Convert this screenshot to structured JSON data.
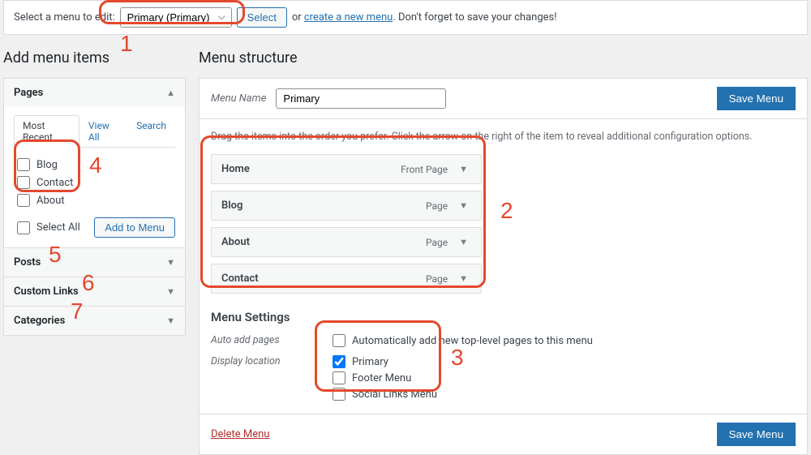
{
  "editBar": {
    "labelPre": "Select a menu to edit:",
    "dropdownValue": "Primary (Primary)",
    "selectBtn": "Select",
    "or": "or",
    "createLink": "create a new menu",
    "labelPost": ". Don't forget to save your changes!"
  },
  "left": {
    "title": "Add menu items",
    "pages": {
      "header": "Pages",
      "tabs": {
        "recent": "Most Recent",
        "viewAll": "View All",
        "search": "Search"
      },
      "items": [
        "Blog",
        "Contact",
        "About"
      ],
      "selectAll": "Select All",
      "addBtn": "Add to Menu"
    },
    "posts": "Posts",
    "customLinks": "Custom Links",
    "categories": "Categories"
  },
  "right": {
    "title": "Menu structure",
    "nameLabel": "Menu Name",
    "nameValue": "Primary",
    "saveBtn": "Save Menu",
    "instruction": "Drag the items into the order you prefer. Click the arrow on the right of the item to reveal additional configuration options.",
    "menuItems": [
      {
        "title": "Home",
        "type": "Front Page"
      },
      {
        "title": "Blog",
        "type": "Page"
      },
      {
        "title": "About",
        "type": "Page"
      },
      {
        "title": "Contact",
        "type": "Page"
      }
    ],
    "settings": {
      "title": "Menu Settings",
      "autoAddLabel": "Auto add pages",
      "autoAddOption": "Automatically add new top-level pages to this menu",
      "displayLabel": "Display location",
      "locations": [
        {
          "label": "Primary",
          "checked": true
        },
        {
          "label": "Footer Menu",
          "checked": false
        },
        {
          "label": "Social Links Menu",
          "checked": false
        }
      ]
    },
    "deleteLink": "Delete Menu"
  },
  "annotations": {
    "n1": "1",
    "n2": "2",
    "n3": "3",
    "n4": "4",
    "n5": "5",
    "n6": "6",
    "n7": "7"
  }
}
